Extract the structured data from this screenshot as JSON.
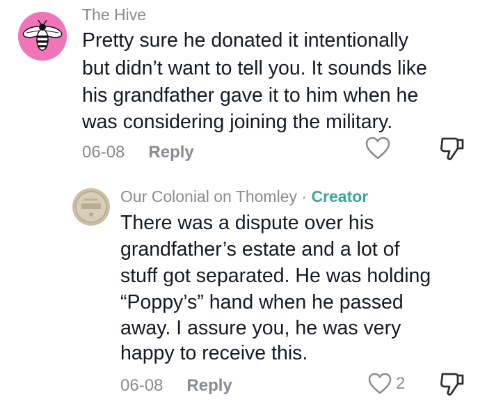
{
  "comments": [
    {
      "username": "The Hive",
      "avatar_icon": "bee-icon",
      "avatar_color": "#f075b8",
      "lines": [
        "Pretty sure he donated it intentionally",
        "but didn’t want to tell you. It sounds like",
        "his grandfather gave it to him when he",
        "was considering joining the military."
      ],
      "date": "06-08",
      "reply_label": "Reply",
      "like_icon": "heart-icon",
      "dislike_icon": "thumbs-down-icon"
    },
    {
      "username": "Our Colonial on Thomley",
      "separator": "·",
      "badge": "Creator",
      "badge_color": "#3aa89a",
      "avatar_icon": "coin-avatar-icon",
      "lines": [
        "There was a dispute over his",
        "grandfather’s estate and a lot of",
        "stuff got separated. He was holding",
        "“Poppy’s” hand when he passed",
        "away. I assure you, he was very",
        "happy to receive this."
      ],
      "date": "06-08",
      "reply_label": "Reply",
      "like_icon": "heart-icon",
      "like_count": "2",
      "dislike_icon": "thumbs-down-icon"
    }
  ]
}
